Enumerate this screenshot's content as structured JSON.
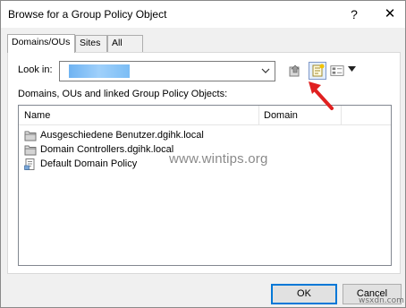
{
  "window": {
    "title": "Browse for a Group Policy Object",
    "help_glyph": "?",
    "close_glyph": "✕"
  },
  "tabs": [
    {
      "label": "Domains/OUs",
      "active": true
    },
    {
      "label": "Sites",
      "active": false
    },
    {
      "label": "All",
      "active": false
    }
  ],
  "lookin": {
    "label": "Look in:",
    "value_redacted": true
  },
  "description": "Domains, OUs and linked Group Policy Objects:",
  "list": {
    "columns": [
      "Name",
      "Domain"
    ],
    "rows": [
      {
        "name": "Ausgeschiedene Benutzer.dgihk.local",
        "domain": "",
        "icon": "folder-ou-icon"
      },
      {
        "name": "Domain Controllers.dgihk.local",
        "domain": "",
        "icon": "folder-ou-icon"
      },
      {
        "name": "Default Domain Policy",
        "domain": "",
        "icon": "gpo-icon"
      }
    ]
  },
  "watermark": "www.wintips.org",
  "buttons": {
    "ok": "OK",
    "cancel": "Cancel"
  },
  "corner_watermark": "wsxdn.com",
  "colors": {
    "accent": "#0078d7",
    "arrow": "#e02020"
  }
}
